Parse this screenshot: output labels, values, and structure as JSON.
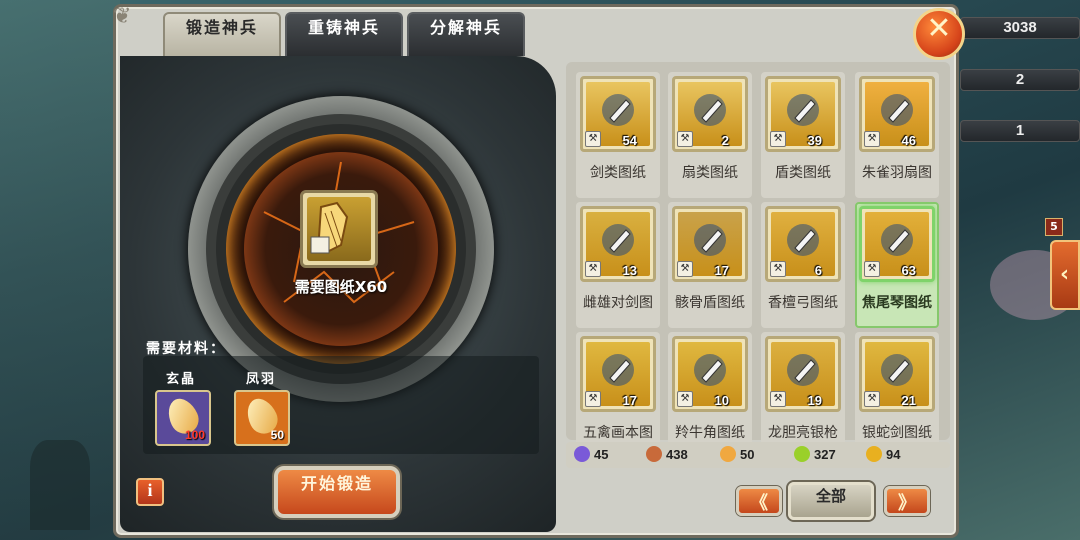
{
  "tabs": [
    {
      "label": "锻造神兵",
      "active": true
    },
    {
      "label": "重铸神兵",
      "active": false
    },
    {
      "label": "分解神兵",
      "active": false
    }
  ],
  "top_counters": [
    "3038",
    "2",
    "1"
  ],
  "side_badge": "5",
  "forge": {
    "need_text": "需要图纸X60",
    "materials_title": "需要材料：",
    "materials": [
      {
        "name": "玄晶",
        "count": "100",
        "count_color": "#ff3a2a",
        "bg": "#5a4a9a"
      },
      {
        "name": "凤羽",
        "count": "50",
        "count_color": "#ffffff",
        "bg": "#d7701c"
      }
    ],
    "start_label": "开始锻造",
    "info_label": "i"
  },
  "items": [
    {
      "name": "剑类图纸",
      "count": "54",
      "icon": "sword-scroll-icon",
      "selected": false
    },
    {
      "name": "扇类图纸",
      "count": "2",
      "icon": "fan-scroll-icon",
      "selected": false
    },
    {
      "name": "盾类图纸",
      "count": "39",
      "icon": "shield-scroll-icon",
      "selected": false
    },
    {
      "name": "朱雀羽扇图",
      "count": "46",
      "icon": "phoenix-fan-icon",
      "selected": false
    },
    {
      "name": "雌雄对剑图",
      "count": "13",
      "icon": "twin-swords-icon",
      "selected": false
    },
    {
      "name": "骸骨盾图纸",
      "count": "17",
      "icon": "skull-shield-icon",
      "selected": false
    },
    {
      "name": "香檀弓图纸",
      "count": "6",
      "icon": "bow-icon",
      "selected": false
    },
    {
      "name": "焦尾琴图纸",
      "count": "63",
      "icon": "zither-icon",
      "selected": true
    },
    {
      "name": "五禽画本图",
      "count": "17",
      "icon": "scroll-painting-icon",
      "selected": false
    },
    {
      "name": "羚牛角图纸",
      "count": "10",
      "icon": "horn-icon",
      "selected": false
    },
    {
      "name": "龙胆亮银枪",
      "count": "19",
      "icon": "spear-icon",
      "selected": false
    },
    {
      "name": "银蛇剑图纸",
      "count": "21",
      "icon": "snake-sword-icon",
      "selected": false
    }
  ],
  "resources": [
    {
      "icon": "crystal-icon",
      "value": "45",
      "color": "#7a5ad8"
    },
    {
      "icon": "scroll-icon",
      "value": "438",
      "color": "#c86a3a"
    },
    {
      "icon": "feather-icon",
      "value": "50",
      "color": "#f0a840"
    },
    {
      "icon": "helmet-icon",
      "value": "327",
      "color": "#9ad02a"
    },
    {
      "icon": "gold-feather-icon",
      "value": "94",
      "color": "#e8b020"
    }
  ],
  "pager": {
    "prev": "《",
    "next": "》",
    "all_label": "全部"
  },
  "close_label": "✕"
}
